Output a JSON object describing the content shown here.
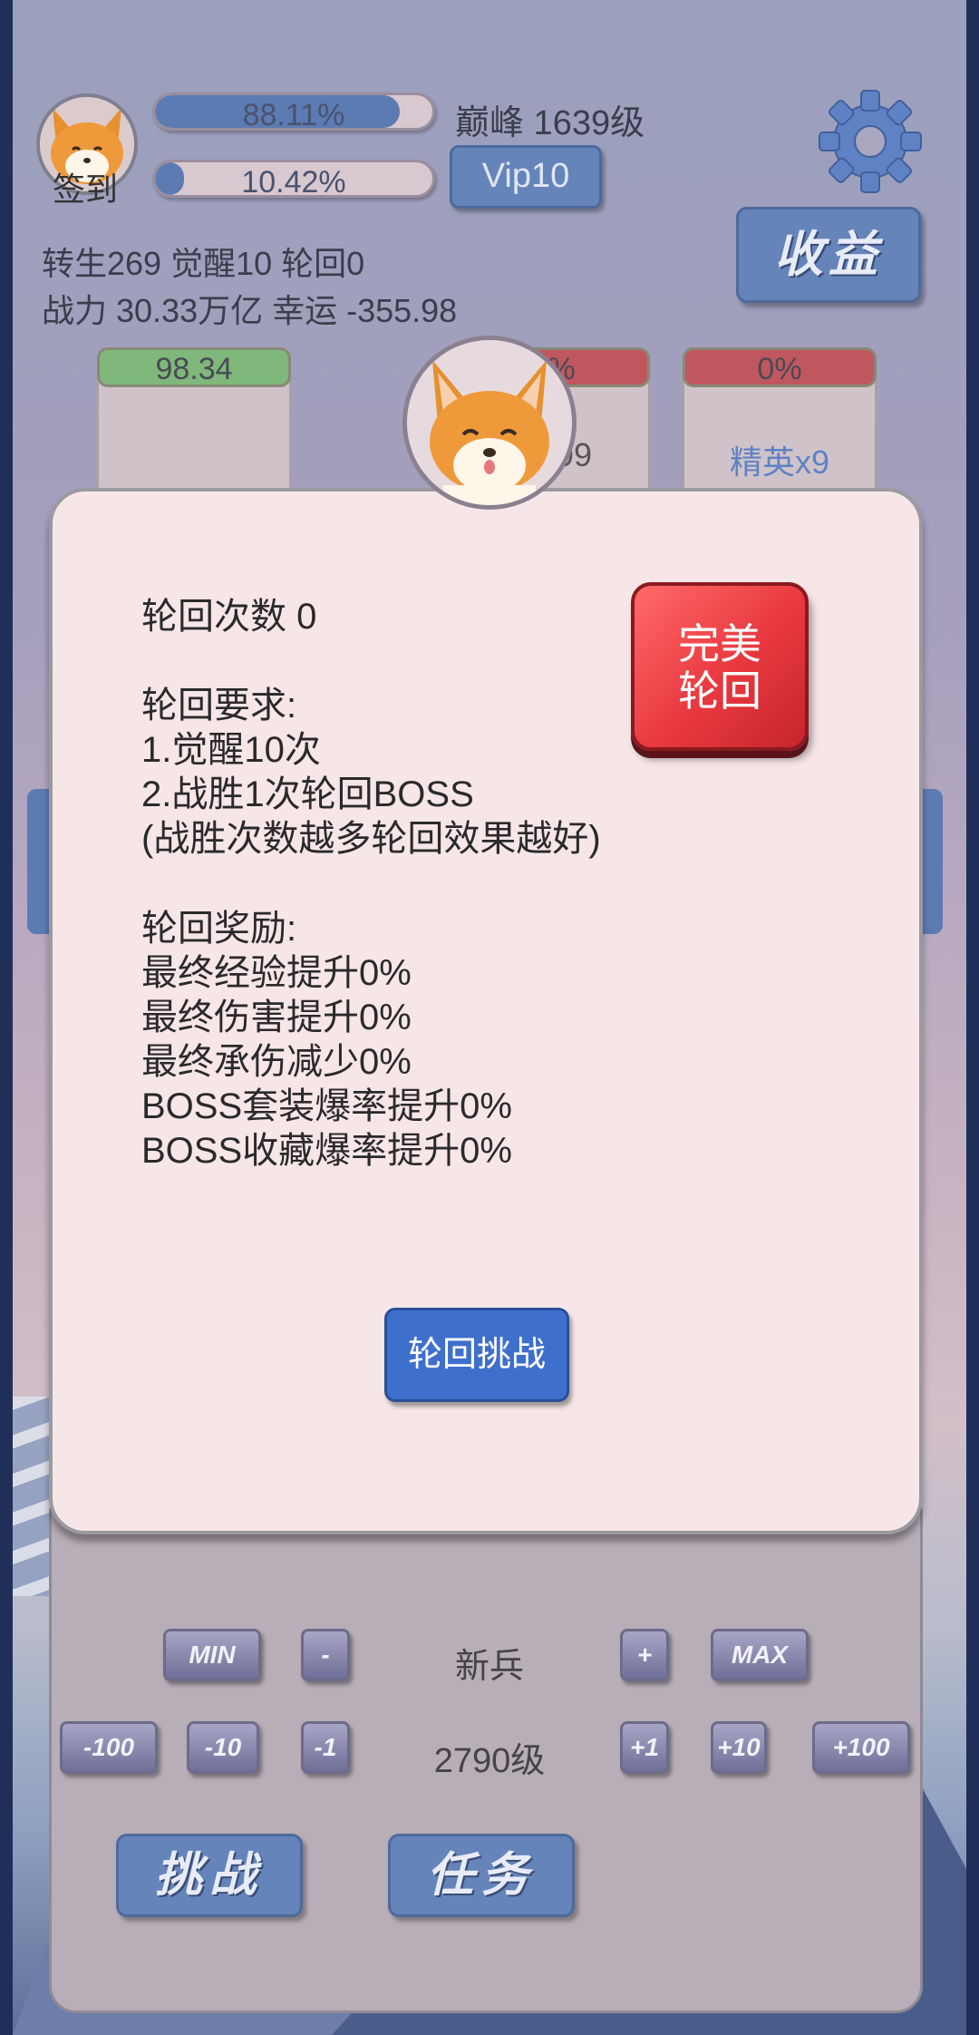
{
  "header": {
    "checkin_label": "签到",
    "exp_bar": {
      "value": 0.8811,
      "label": "88.11%"
    },
    "second_bar": {
      "value": 0.1042,
      "label": "10.42%"
    },
    "level_text": "巅峰 1639级",
    "vip_label": "Vip10",
    "income_label": "收益",
    "stats_line1": "转生269 觉醒10 轮回0",
    "stats_line2": "战力 30.33万亿  幸运 -355.98"
  },
  "stage_cards": [
    {
      "bar_text": "98.34",
      "bar_color": "#7fb87a",
      "label": ""
    },
    {
      "bar_text": "0%",
      "bar_color": "#c0575f",
      "label": "x99"
    },
    {
      "bar_text": "0%",
      "bar_color": "#c0575f",
      "label": "精英x9"
    }
  ],
  "modal": {
    "count_text": "轮回次数 0",
    "requirements_text": "轮回要求:\n1.觉醒10次\n2.战胜1次轮回BOSS\n(战胜次数越多轮回效果越好)",
    "rewards_text": "轮回奖励:\n最终经验提升0%\n最终伤害提升0%\n最终承伤减少0%\nBOSS套装爆率提升0%\nBOSS收藏爆率提升0%",
    "perfect_line1": "完美",
    "perfect_line2": "轮回",
    "challenge_label": "轮回挑战"
  },
  "controls": {
    "row1": {
      "min": "MIN",
      "minus": "-",
      "center": "新兵",
      "plus": "+",
      "max": "MAX"
    },
    "row2": {
      "m100": "-100",
      "m10": "-10",
      "m1": "-1",
      "center": "2790级",
      "p1": "+1",
      "p10": "+10",
      "p100": "+100"
    },
    "challenge": "挑战",
    "task": "任务"
  },
  "colors": {
    "accent_blue": "#6584ba",
    "perfect_red": "#e8383f",
    "modal_bg": "#f7e6e8"
  }
}
